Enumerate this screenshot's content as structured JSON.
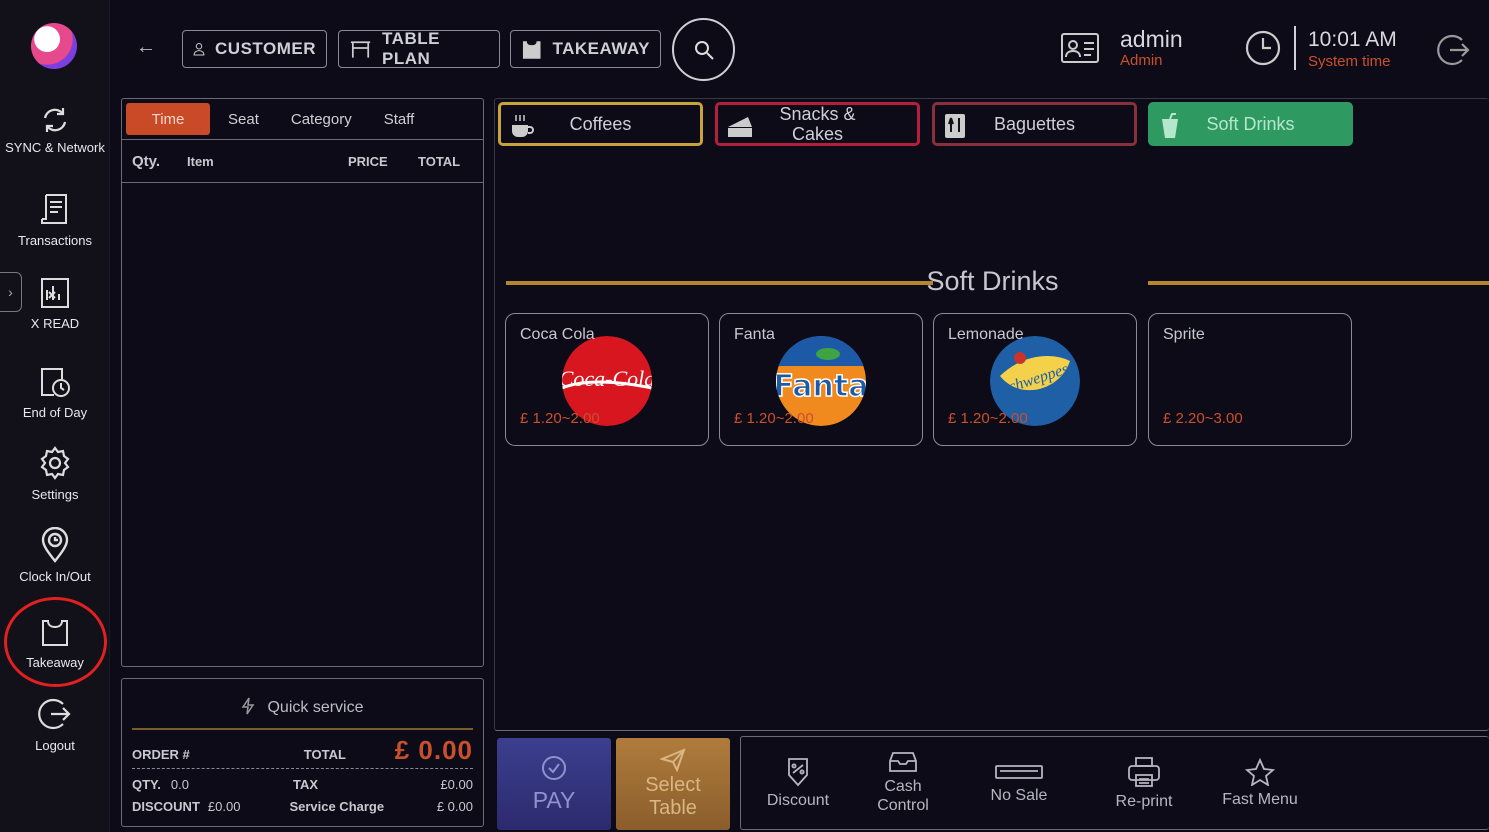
{
  "sidebar": {
    "items": [
      {
        "label": "SYNC & Network",
        "icon": "sync-icon"
      },
      {
        "label": "Transactions",
        "icon": "receipt-icon"
      },
      {
        "label": "X READ",
        "icon": "x-report-icon"
      },
      {
        "label": "End of Day",
        "icon": "end-of-day-icon"
      },
      {
        "label": "Settings",
        "icon": "gear-icon"
      },
      {
        "label": "Clock In/Out",
        "icon": "location-clock-icon"
      },
      {
        "label": "Takeaway",
        "icon": "takeaway-bag-icon"
      },
      {
        "label": "Logout",
        "icon": "logout-icon"
      }
    ]
  },
  "topbar": {
    "customer": "CUSTOMER",
    "table_plan": "TABLE PLAN",
    "takeaway": "TAKEAWAY",
    "user_name": "admin",
    "user_role": "Admin",
    "time": "10:01 AM",
    "time_label": "System time"
  },
  "order": {
    "tabs": [
      "Time",
      "Seat",
      "Category",
      "Staff"
    ],
    "columns": {
      "qty": "Qty.",
      "item": "Item",
      "price": "PRICE",
      "total": "TOTAL"
    }
  },
  "summary": {
    "quick_service": "Quick service",
    "order_label": "ORDER #",
    "total_label": "TOTAL",
    "total_value": "£ 0.00",
    "qty_label": "QTY.",
    "qty_value": "0.0",
    "tax_label": "TAX",
    "tax_value": "£0.00",
    "discount_label": "DISCOUNT",
    "discount_value": "£0.00",
    "service_label": "Service Charge",
    "service_value": "£ 0.00"
  },
  "categories": [
    {
      "label": "Coffees",
      "color": "#c8a23a",
      "icon": "coffee-cup-icon"
    },
    {
      "label": "Snacks & Cakes",
      "color": "#b51e3c",
      "icon": "cake-icon"
    },
    {
      "label": "Baguettes",
      "color": "#8a2f3c",
      "icon": "baguette-icon"
    },
    {
      "label": "Soft Drinks",
      "color": "#2e9a62",
      "icon": "soft-drink-icon"
    }
  ],
  "section_title": "Soft Drinks",
  "products": [
    {
      "name": "Coca Cola",
      "price": "£ 1.20~2.00"
    },
    {
      "name": "Fanta",
      "price": "£ 1.20~2.00"
    },
    {
      "name": "Lemonade",
      "price": "£ 1.20~2.00"
    },
    {
      "name": "Sprite",
      "price": "£ 2.20~3.00"
    }
  ],
  "product_logos": {
    "coke": "Coca-Cola",
    "fanta": "Fanta",
    "lemonade": "Schweppes"
  },
  "bottom": {
    "pay": "PAY",
    "select_table": "Select Table",
    "actions": [
      {
        "label": "Discount",
        "icon": "discount-icon"
      },
      {
        "label": "Cash Control",
        "icon": "cash-drawer-icon"
      },
      {
        "label": "No Sale",
        "icon": "no-sale-icon"
      },
      {
        "label": "Re-print",
        "icon": "printer-icon"
      },
      {
        "label": "Fast Menu",
        "icon": "star-icon"
      }
    ]
  }
}
